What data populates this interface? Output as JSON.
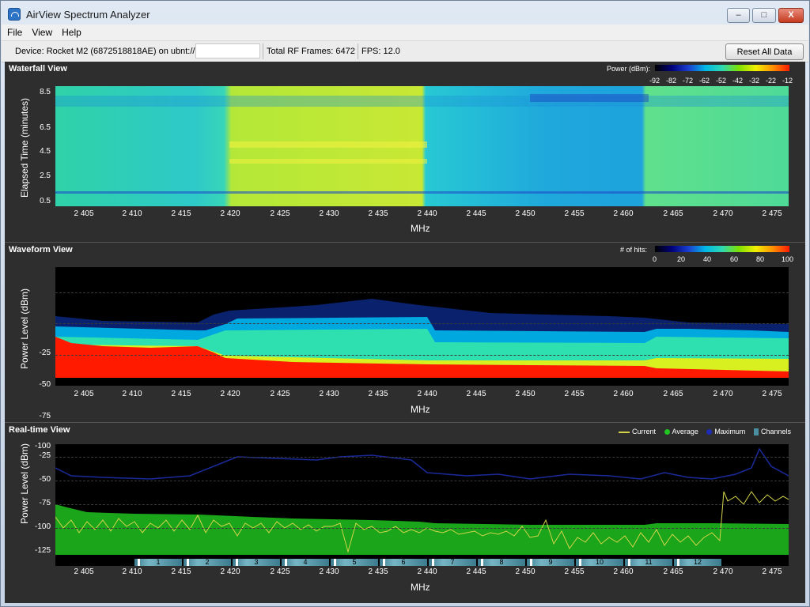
{
  "window": {
    "title": "AirView Spectrum Analyzer",
    "buttons": {
      "minimize": "–",
      "maximize": "□",
      "close": "X"
    }
  },
  "menu": [
    "File",
    "View",
    "Help"
  ],
  "toolbar": {
    "device_label": "Device: Rocket M2 (6872518818AE) on ubnt://",
    "frames_label": "Total RF Frames: 6472",
    "fps_label": "FPS: 12.0",
    "reset_label": "Reset All Data"
  },
  "x_ticks": [
    "2 405",
    "2 410",
    "2 415",
    "2 420",
    "2 425",
    "2 430",
    "2 435",
    "2 440",
    "2 445",
    "2 450",
    "2 455",
    "2 460",
    "2 465",
    "2 470",
    "2 475"
  ],
  "x_label": "MHz",
  "waterfall": {
    "title": "Waterfall View",
    "ylabel": "Elapsed Time (minutes)",
    "yticks": [
      "8.5",
      "6.5",
      "4.5",
      "2.5",
      "0.5"
    ],
    "scale_label": "Power (dBm):",
    "scale_values": [
      "-92",
      "-82",
      "-72",
      "-62",
      "-52",
      "-42",
      "-32",
      "-22",
      "-12"
    ]
  },
  "waveform": {
    "title": "Waveform View",
    "ylabel": "Power Level (dBm)",
    "yticks": [
      "-25",
      "-50",
      "-75",
      "-100"
    ],
    "scale_label": "# of hits:",
    "scale_values": [
      "0",
      "20",
      "40",
      "60",
      "80",
      "100"
    ]
  },
  "realtime": {
    "title": "Real-time View",
    "ylabel": "Power Level (dBm)",
    "yticks": [
      "-25",
      "-50",
      "-75",
      "-100",
      "-125"
    ],
    "legend": [
      {
        "label": "Current",
        "color": "#d4d44a"
      },
      {
        "label": "Average",
        "color": "#22c422"
      },
      {
        "label": "Maximum",
        "color": "#1e2cb8"
      },
      {
        "label": "Channels",
        "color": "#4a8fa0"
      }
    ],
    "channels": [
      "1",
      "2",
      "3",
      "4",
      "5",
      "6",
      "7",
      "8",
      "9",
      "10",
      "11",
      "12"
    ]
  }
}
